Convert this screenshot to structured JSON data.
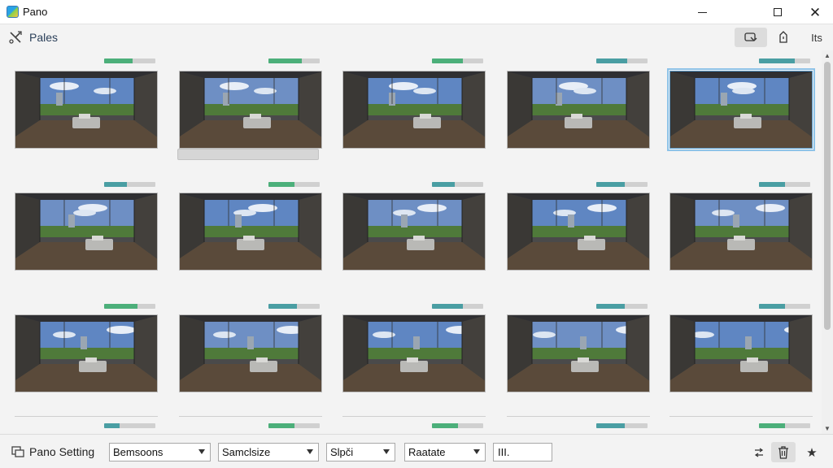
{
  "window": {
    "title": "Pano",
    "minimize_label": "",
    "maximize_label": "",
    "close_label": "✕"
  },
  "toolbar": {
    "title": "Pales",
    "right_text": "Its"
  },
  "grid": {
    "rows": [
      [
        {
          "progress": 0.55,
          "color": "#4caf7a",
          "selected": false
        },
        {
          "progress": 0.65,
          "color": "#4caf7a",
          "selected": false
        },
        {
          "progress": 0.6,
          "color": "#4caf7a",
          "selected": false
        },
        {
          "progress": 0.6,
          "color": "#4a9ea3",
          "selected": false
        },
        {
          "progress": 0.7,
          "color": "#4a9ea3",
          "selected": true
        }
      ],
      [
        {
          "progress": 0.45,
          "color": "#4a9ea3",
          "selected": false
        },
        {
          "progress": 0.5,
          "color": "#4caf7a",
          "selected": false
        },
        {
          "progress": 0.45,
          "color": "#4a9ea3",
          "selected": false
        },
        {
          "progress": 0.55,
          "color": "#4a9ea3",
          "selected": false
        },
        {
          "progress": 0.5,
          "color": "#4a9ea3",
          "selected": false
        }
      ],
      [
        {
          "progress": 0.65,
          "color": "#4caf7a",
          "selected": false
        },
        {
          "progress": 0.55,
          "color": "#4a9ea3",
          "selected": false
        },
        {
          "progress": 0.6,
          "color": "#4a9ea3",
          "selected": false
        },
        {
          "progress": 0.55,
          "color": "#4a9ea3",
          "selected": false
        },
        {
          "progress": 0.5,
          "color": "#4a9ea3",
          "selected": false
        }
      ],
      [
        {
          "progress": 0.3,
          "color": "#4a9ea3",
          "selected": false
        },
        {
          "progress": 0.5,
          "color": "#4caf7a",
          "selected": false
        },
        {
          "progress": 0.5,
          "color": "#4caf7a",
          "selected": false
        },
        {
          "progress": 0.55,
          "color": "#4a9ea3",
          "selected": false
        },
        {
          "progress": 0.5,
          "color": "#4caf7a",
          "selected": false
        }
      ]
    ]
  },
  "bottombar": {
    "title": "Pano Setting",
    "dropdowns": [
      {
        "value": "Bemsoons"
      },
      {
        "value": "Samclsize"
      },
      {
        "value": "Slpči"
      },
      {
        "value": "Raatate"
      }
    ],
    "input_value": "III."
  },
  "icons": {
    "app": "app-logo-icon",
    "toolbar_left": "tools-icon",
    "toolbar_btn1": "rotate-view-icon",
    "toolbar_btn2": "tag-icon",
    "bottom_left": "settings-panel-icon",
    "bottom_a": "swap-icon",
    "bottom_b": "trash-icon",
    "bottom_c": "star-icon"
  }
}
